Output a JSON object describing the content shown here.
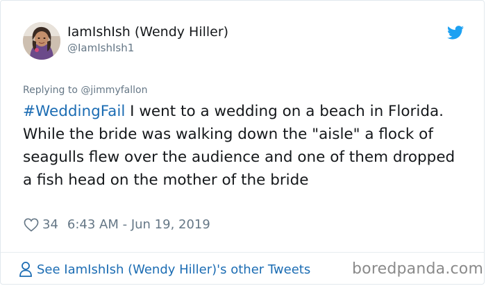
{
  "tweet": {
    "author": {
      "display_name": "IamIshIsh (Wendy Hiller)",
      "handle": "@IamIshIsh1"
    },
    "replying_prefix": "Replying to ",
    "replying_to": "@jimmyfallon",
    "hashtag": "#WeddingFail",
    "body": " I went to a wedding on a beach in Florida. While the bride was walking down the \"aisle\" a flock of seagulls flew over the audience and one of them dropped a fish head on the mother of the bride",
    "likes": "34",
    "timestamp": "6:43 AM - Jun 19, 2019"
  },
  "footer": {
    "link_text": "See IamIshIsh (Wendy Hiller)'s other Tweets"
  },
  "watermark": "boredpanda.com",
  "icons": {
    "platform": "twitter-bird-icon",
    "like": "heart-icon",
    "profile": "person-icon"
  },
  "colors": {
    "link": "#1b6cb3",
    "twitter_blue": "#1da1f2",
    "muted": "#657786",
    "text": "#14171a"
  }
}
